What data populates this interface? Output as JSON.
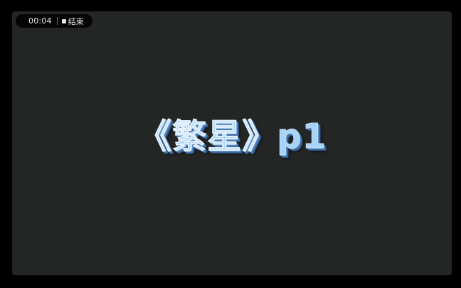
{
  "recorder": {
    "timer": "00:04",
    "stop_label": "结束"
  },
  "slide": {
    "title": "《繁星》p1"
  },
  "colors": {
    "background": "#232624",
    "title_fill": "#a9d3f5",
    "title_shadow": "#3c689f"
  },
  "icons": {
    "stop": "stop-square-icon"
  }
}
